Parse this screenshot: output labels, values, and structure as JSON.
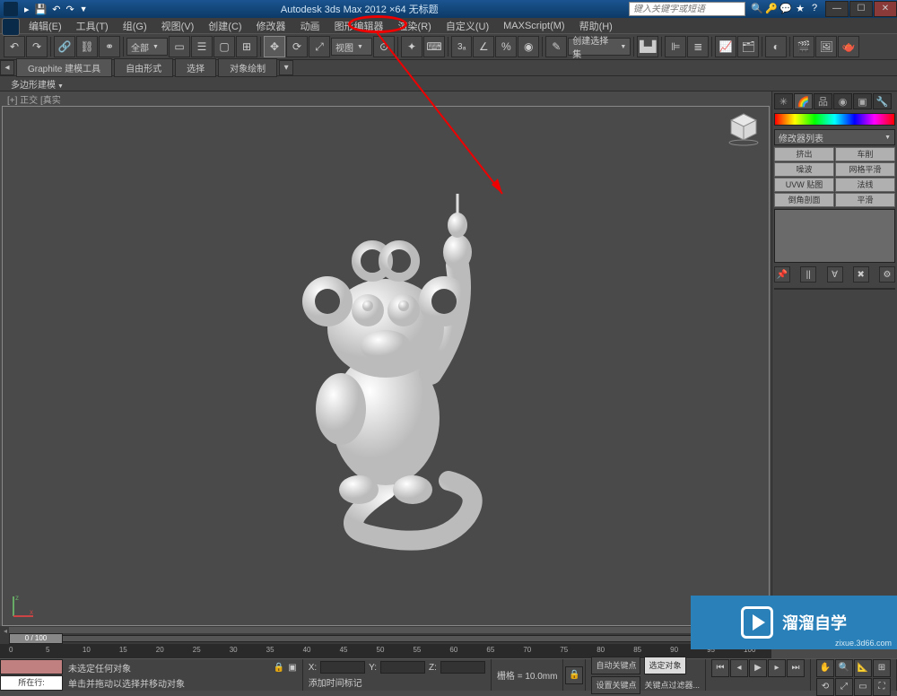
{
  "titlebar": {
    "title": "Autodesk 3ds Max 2012 ×64   无标题",
    "search_placeholder": "键入关键字或短语"
  },
  "menubar": {
    "items": [
      "编辑(E)",
      "工具(T)",
      "组(G)",
      "视图(V)",
      "创建(C)",
      "修改器",
      "动画",
      "图形编辑器",
      "渲染(R)",
      "自定义(U)",
      "MAXScript(M)",
      "帮助(H)"
    ]
  },
  "toolbar": {
    "scope_combo": "全部",
    "view_combo": "视图",
    "snap_label": "3",
    "selection_combo": "创建选择集"
  },
  "ribbon": {
    "tabs": [
      "Graphite 建模工具",
      "自由形式",
      "选择",
      "对象绘制"
    ],
    "sub": "多边形建模"
  },
  "viewport": {
    "label": "[+] 正交 [真实"
  },
  "command_panel": {
    "modifier_list": "修改器列表",
    "buttons": [
      "挤出",
      "车削",
      "噪波",
      "网格平滑",
      "UVW 贴图",
      "法线",
      "倒角剖面",
      "平滑"
    ]
  },
  "timeline": {
    "handle": "0 / 100",
    "ticks": [
      "0",
      "5",
      "10",
      "15",
      "20",
      "25",
      "30",
      "35",
      "40",
      "45",
      "50",
      "55",
      "60",
      "65",
      "70",
      "75",
      "80",
      "85",
      "90",
      "95",
      "100"
    ]
  },
  "statusbar": {
    "selected_label": "所在行:",
    "msg1": "未选定任何对象",
    "msg2": "单击并拖动以选择并移动对象",
    "lock_icon": "🔒",
    "x_label": "X:",
    "y_label": "Y:",
    "z_label": "Z:",
    "grid": "栅格 = 10.0mm",
    "add_time": "添加时间标记",
    "autokey": "自动关键点",
    "selection_btn": "选定对象",
    "setkey": "设置关键点",
    "keyfilter": "关键点过滤器..."
  },
  "watermark": {
    "text": "溜溜自学",
    "url": "zixue.3d66.com"
  }
}
